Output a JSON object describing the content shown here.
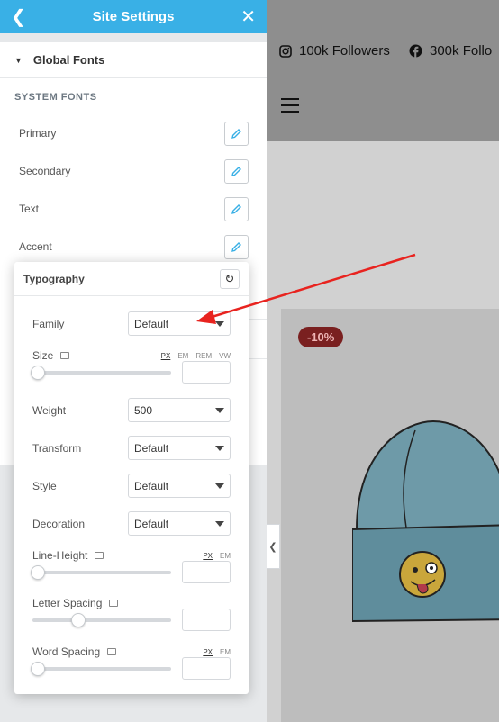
{
  "preview": {
    "social": [
      {
        "icon": "instagram-icon",
        "label": "100k Followers"
      },
      {
        "icon": "facebook-icon",
        "label": "300k Follo"
      }
    ],
    "badge": "-10%"
  },
  "panel": {
    "title": "Site Settings",
    "section_title": "Global Fonts",
    "system_fonts_label": "SYSTEM FONTS",
    "fonts": [
      "Primary",
      "Secondary",
      "Text",
      "Accent"
    ]
  },
  "typography": {
    "title": "Typography",
    "family_label": "Family",
    "family_value": "Default",
    "size_label": "Size",
    "size_units": [
      "PX",
      "EM",
      "REM",
      "VW"
    ],
    "weight_label": "Weight",
    "weight_value": "500",
    "transform_label": "Transform",
    "transform_value": "Default",
    "style_label": "Style",
    "style_value": "Default",
    "decoration_label": "Decoration",
    "decoration_value": "Default",
    "line_height_label": "Line-Height",
    "line_height_units": [
      "PX",
      "EM"
    ],
    "letter_spacing_label": "Letter Spacing",
    "letter_spacing_level": 0.33,
    "word_spacing_label": "Word Spacing",
    "word_spacing_units": [
      "PX",
      "EM"
    ]
  },
  "colors": {
    "header": "#39b0e6",
    "badge": "#7a2020",
    "arrow": "#e8231f"
  }
}
